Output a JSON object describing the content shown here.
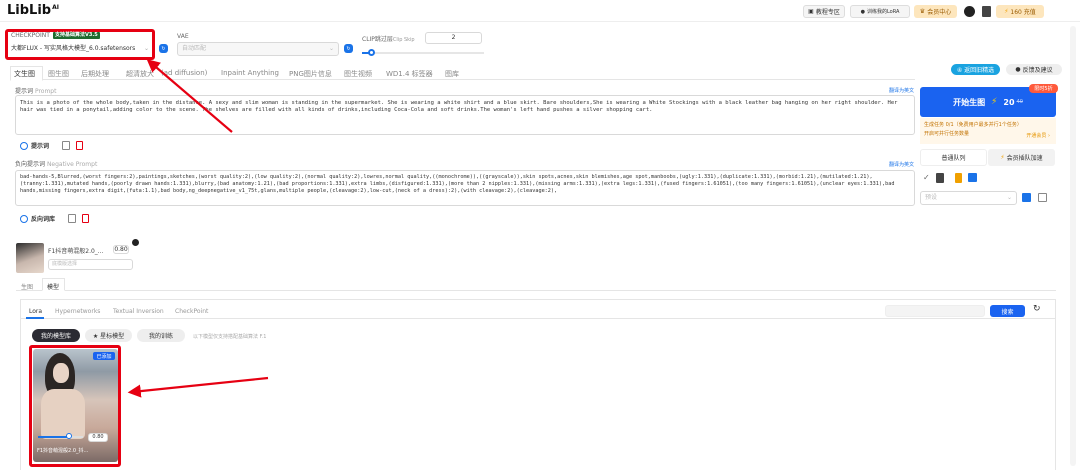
{
  "header": {
    "logo": "LibLib",
    "logo_ai": "AI",
    "tutorial": "教程专区",
    "train_lora": "训练我的LoRA",
    "member_center": "会员中心",
    "recharge": "160 充值"
  },
  "checkpoint": {
    "label": "CHECKPOINT",
    "badge": "支持基础算法V3.5",
    "value": "大都FLUX - 写实风格大模型_6.0.safetensors"
  },
  "vae": {
    "label": "VAE",
    "placeholder": "自动匹配"
  },
  "clip": {
    "label": "CLIP跳过层",
    "sub": "Clip Skip",
    "value": "2"
  },
  "tabs": [
    "文生图",
    "图生图",
    "后期处理",
    "超清放大",
    "(ad diffusion)",
    "Inpaint Anything",
    "PNG图片信息",
    "图生视频",
    "WD1.4 标签器",
    "图库"
  ],
  "top_right": {
    "recommend": "④ 返回旧精选",
    "feedback": "反馈及建议"
  },
  "prompt": {
    "label": "提示词",
    "sub": "Prompt",
    "translate": "翻译为英文",
    "text": "This is a photo of the whole body,taken in the distance. A sexy and slim woman is standing in the supermarket. She is wearing a white shirt and a blue skirt. Bare shoulders,She is wearing a White Stockings with a black leather bag hanging on her right shoulder. Her hair was tied in a ponytail,adding color to the scene. The shelves are filled with all kinds of drinks,including Coca-Cola and soft drinks.The woman's left hand pushes a silver shopping cart.",
    "tool": "提示词"
  },
  "negative": {
    "label": "负向提示词",
    "sub": "Negative Prompt",
    "translate": "翻译为英文",
    "text": "bad-hands-5,Blurred,(worst fingers:2),paintings,sketches,(worst quality:2),(low quality:2),(normal quality:2),lowres,normal quality,((monochrome)),((grayscale)),skin spots,acnes,skin blemishes,age spot,manboobs,(ugly:1.331),(duplicate:1.331),(morbid:1.21),(mutilated:1.21),(tranny:1.331),mutated hands,(poorly drawn hands:1.331),blurry,(bad anatomy:1.21),(bad proportions:1.331),extra limbs,(disfigured:1.331),(more than 2 nipples:1.331),(missing arms:1.331),(extra legs:1.331),(fused fingers:1.61051),(too many fingers:1.61051),(unclear eyes:1.331),bad hands,missing fingers,extra digit,(futa:1.1),bad body,ng_deepnegative_v1_75t,glans,multiple people,(cleavage:2),low-cut,(neck of a dress):2),(with cleavage:2),(cleavage:2),",
    "tool": "反向词库"
  },
  "generate": {
    "label": "开始生图",
    "cost": "20",
    "cost_sub": "40",
    "limited": "限时5折",
    "task_line1": "生成任务 0/1（免费用户最多并行1个任务）",
    "task_line2": "开启可并行任务数量",
    "open_member": "开通会员 ›",
    "queue_normal": "普通队列",
    "queue_fast": "会员插队加速",
    "preset_placeholder": "预设"
  },
  "lora_item": {
    "name": "F1抖音萌混般2.0_...",
    "sub": "底模版选择",
    "weight": "0.80"
  },
  "sub_tabs": [
    "生图",
    "模型"
  ],
  "model_tabs": [
    "Lora",
    "Hypernetworks",
    "Textual Inversion",
    "CheckPoint"
  ],
  "search_button": "搜索",
  "lib_buttons": [
    "我的模型库",
    "★ 星标模型",
    "我的训练"
  ],
  "lib_note": "以下模型仅支持搭配基础算法 F.1",
  "card": {
    "badge": "已添加",
    "weight": "0.80",
    "name": "F1抖音萌混般2.0_抖..."
  },
  "colors": {
    "accent": "#1a73e8",
    "red": "#e60012",
    "generate": "#1a63f0",
    "dark": "#2b2b33"
  }
}
